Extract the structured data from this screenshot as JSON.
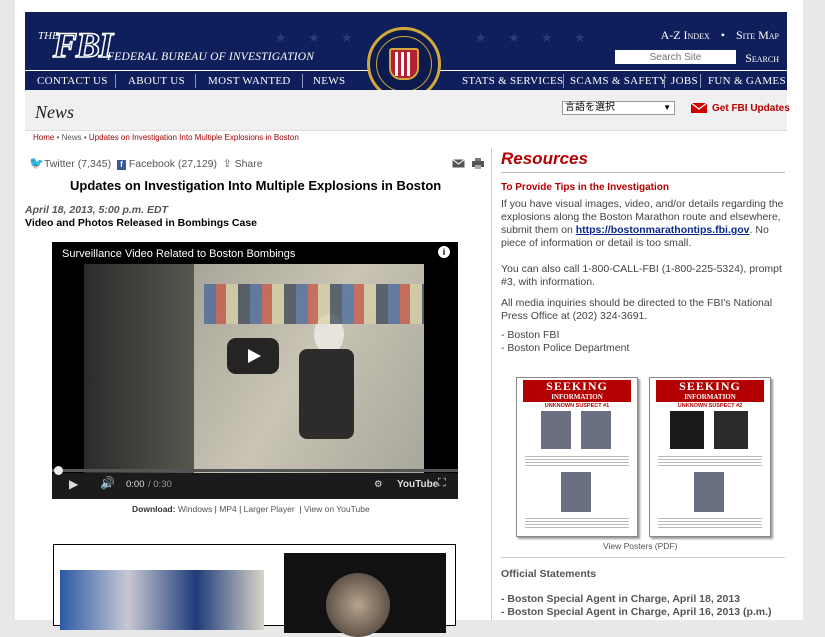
{
  "header": {
    "logo_the": "THE",
    "logo_fbi": "FBI",
    "logo_sub": "FEDERAL BUREAU OF INVESTIGATION",
    "az_index": "A-Z Index",
    "site_map": "Site Map",
    "search_placeholder": "Search Site",
    "search_button": "Search",
    "seal_text": "DEPARTMENT OF JUSTICE · FEDERAL BUREAU OF INVESTIGATION"
  },
  "nav": {
    "left": [
      "CONTACT US",
      "ABOUT US",
      "MOST WANTED",
      "NEWS"
    ],
    "right": [
      "STATS & SERVICES",
      "SCAMS & SAFETY",
      "JOBS",
      "FUN & GAMES"
    ]
  },
  "newsbar": {
    "title": "News",
    "language_select": "言語を選択",
    "get_updates": "Get FBI Updates"
  },
  "breadcrumb": {
    "home": "Home",
    "news": "News",
    "current": "Updates on Investigation Into Multiple Explosions in Boston"
  },
  "share": {
    "twitter": "Twitter",
    "twitter_count": "(7,345)",
    "facebook": "Facebook",
    "facebook_count": "(27,129)",
    "share": "Share"
  },
  "article": {
    "title": "Updates on Investigation Into Multiple Explosions in Boston",
    "date": "April 18, 2013, 5:00 p.m. EDT",
    "subtitle": "Video and Photos Released in Bombings Case"
  },
  "video": {
    "title": "Surveillance Video Related to Boston Bombings",
    "time": "0:00",
    "duration": "/ 0:30",
    "youtube": "YouTube",
    "progress": 0
  },
  "download": {
    "label": "Download:",
    "windows": "Windows",
    "mp4": "MP4",
    "larger": "Larger Player",
    "youtube": "View on YouTube"
  },
  "sidebar": {
    "heading": "Resources",
    "tips_heading": "To Provide Tips in the Investigation",
    "para1_a": "If you have visual images, video, and/or details regarding the explosions along the Boston Marathon route and elsewhere, submit them on ",
    "para1_link": "https://bostonmarathontips.fbi.gov",
    "para1_b": ". No piece of information or detail is too small.",
    "para2": "You can also call 1-800-CALL-FBI (1-800-225-5324), prompt #3, with information.",
    "para3": "All media inquiries should be directed to the FBI's National Press Office at (202) 324-3691.",
    "contact1": "- Boston FBI",
    "contact2": "- Boston Police Department",
    "poster_title": "SEEKING",
    "poster_title2": "INFORMATION",
    "poster1_sub": "UNKNOWN SUSPECT #1",
    "poster2_sub": "UNKNOWN SUSPECT #2",
    "view_posters": "View Posters (PDF)",
    "official_heading": "Official Statements",
    "statements": [
      "- Boston Special Agent in Charge, April 18, 2013",
      "- Boston Special Agent in Charge, April 16, 2013 (p.m.)"
    ]
  }
}
